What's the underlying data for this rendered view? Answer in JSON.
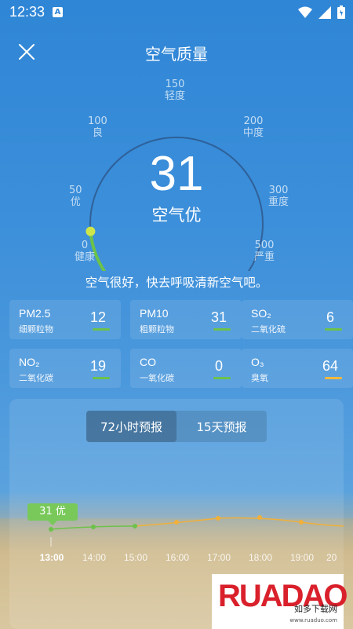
{
  "status_bar": {
    "time": "12:33",
    "notif_letter": "A"
  },
  "header": {
    "title": "空气质量"
  },
  "gauge": {
    "aqi": "31",
    "level": "空气优",
    "aqi_fraction": 0.06,
    "labels": [
      {
        "num": "0",
        "text": "健康"
      },
      {
        "num": "50",
        "text": "优"
      },
      {
        "num": "100",
        "text": "良"
      },
      {
        "num": "150",
        "text": "轻度"
      },
      {
        "num": "200",
        "text": "中度"
      },
      {
        "num": "300",
        "text": "重度"
      },
      {
        "num": "500",
        "text": "严重"
      }
    ]
  },
  "advice": "空气很好，快去呼吸清新空气吧。",
  "pollutants": [
    {
      "name": "PM2.5",
      "desc": "细颗粒物",
      "value": "12",
      "color": "#6cc24a"
    },
    {
      "name": "PM10",
      "desc": "粗颗粒物",
      "value": "31",
      "color": "#6cc24a"
    },
    {
      "name": "SO₂",
      "desc": "二氧化硫",
      "value": "6",
      "color": "#6cc24a"
    },
    {
      "name": "NO₂",
      "desc": "二氧化碳",
      "value": "19",
      "color": "#6cc24a"
    },
    {
      "name": "CO",
      "desc": "一氧化碳",
      "value": "0",
      "color": "#6cc24a"
    },
    {
      "name": "O₃",
      "desc": "臭氧",
      "value": "64",
      "color": "#f5b93a"
    }
  ],
  "forecast": {
    "tabs": [
      "72小时预报",
      "15天预报"
    ],
    "active_tab": 0,
    "badge": "31 优",
    "hours": [
      "13:00",
      "14:00",
      "15:00",
      "16:00",
      "17:00",
      "18:00",
      "19:00",
      "20"
    ]
  },
  "logo": {
    "text": "RUADAO",
    "sub": "如多下载网",
    "url": "www.ruaduo.com"
  }
}
